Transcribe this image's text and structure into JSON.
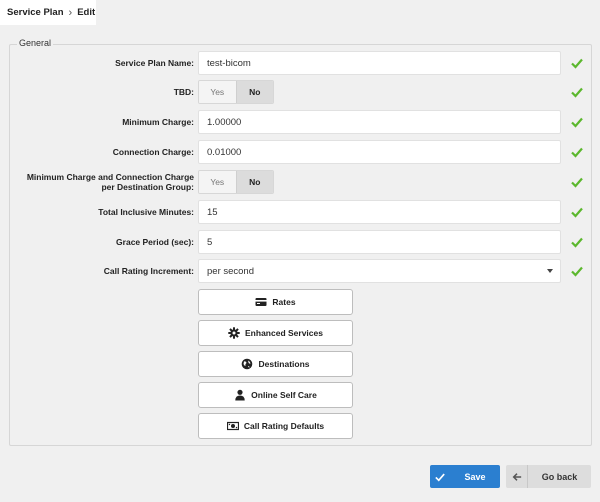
{
  "breadcrumb": {
    "section": "Service Plan",
    "current": "Edit"
  },
  "fieldset": {
    "legend": "General"
  },
  "fields": {
    "plan_name": {
      "label": "Service Plan Name:",
      "value": "test-bicom"
    },
    "tbd": {
      "label": "TBD:",
      "yes": "Yes",
      "no": "No",
      "selected": "No"
    },
    "min_charge": {
      "label": "Minimum Charge:",
      "value": "1.00000"
    },
    "conn_charge": {
      "label": "Connection Charge:",
      "value": "0.01000"
    },
    "min_conn_group": {
      "label_line1": "Minimum Charge and Connection Charge",
      "label_line2": "per Destination Group:",
      "yes": "Yes",
      "no": "No",
      "selected": "No"
    },
    "inclusive_minutes": {
      "label": "Total Inclusive Minutes:",
      "value": "15"
    },
    "grace_period": {
      "label": "Grace Period (sec):",
      "value": "5"
    },
    "rating_increment": {
      "label": "Call Rating Increment:",
      "value": "per second"
    }
  },
  "buttons": {
    "rates": "Rates",
    "enhanced_services": "Enhanced Services",
    "destinations": "Destinations",
    "self_care": "Online Self Care",
    "rating_defaults": "Call Rating Defaults"
  },
  "actions": {
    "save": "Save",
    "back": "Go back"
  },
  "colors": {
    "check": "#5cb82e",
    "primary": "#2b7fd0"
  }
}
